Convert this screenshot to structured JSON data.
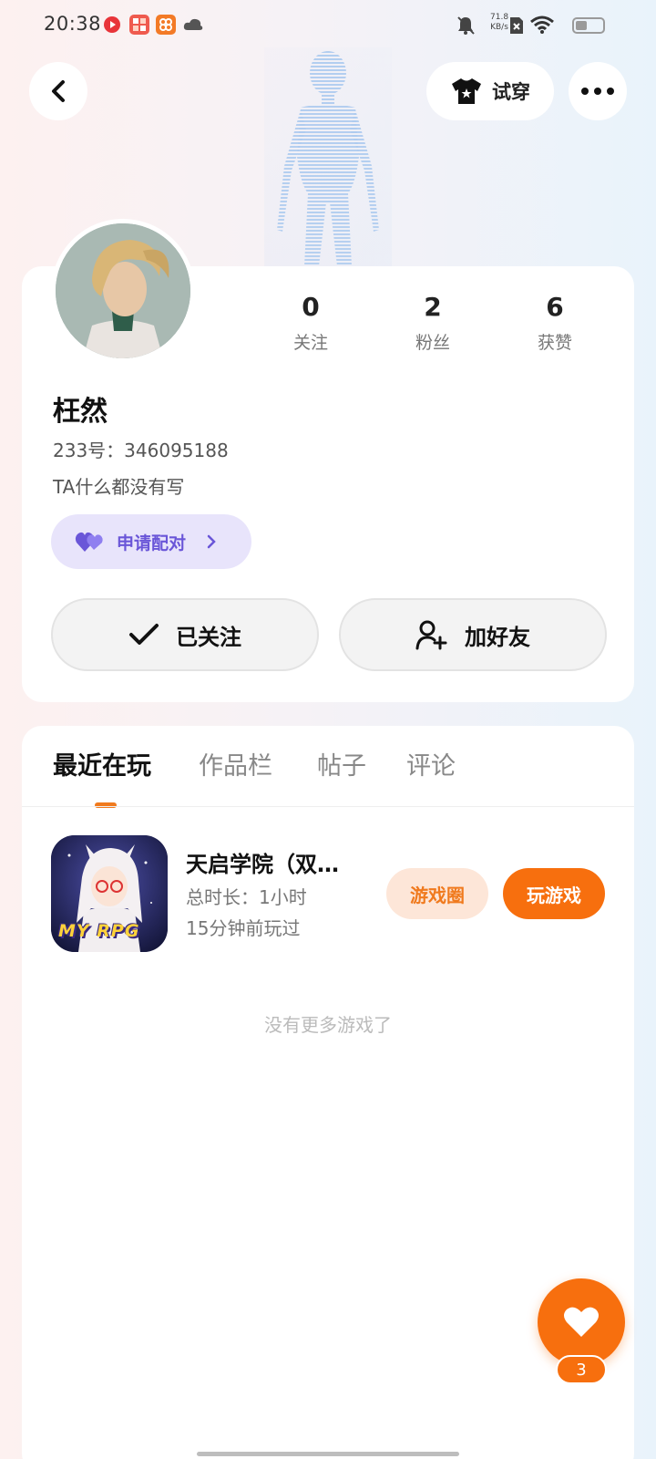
{
  "status_bar": {
    "time": "20:38",
    "net_speed_value": "71.8",
    "net_speed_unit": "KB/s"
  },
  "nav": {
    "try_on_label": "试穿"
  },
  "profile": {
    "username": "枉然",
    "user_id": "233号：346095188",
    "bio": "TA什么都没有写",
    "pair_label": "申请配对",
    "stats": [
      {
        "value": "0",
        "label": "关注"
      },
      {
        "value": "2",
        "label": "粉丝"
      },
      {
        "value": "6",
        "label": "获赞"
      }
    ],
    "followed_label": "已关注",
    "add_friend_label": "加好友"
  },
  "tabs": [
    {
      "label": "最近在玩",
      "active": true
    },
    {
      "label": "作品栏",
      "active": false
    },
    {
      "label": "帖子",
      "active": false
    },
    {
      "label": "评论",
      "active": false
    }
  ],
  "game": {
    "title": "天启学院（双…",
    "icon_text": "MY RPG",
    "total_time": "总时长：1小时",
    "last_played": "15分钟前玩过",
    "circle_label": "游戏圈",
    "play_label": "玩游戏"
  },
  "empty_text": "没有更多游戏了",
  "like": {
    "count": "3"
  },
  "colors": {
    "accent": "#f76f0e",
    "pair": "#6a56d8"
  }
}
